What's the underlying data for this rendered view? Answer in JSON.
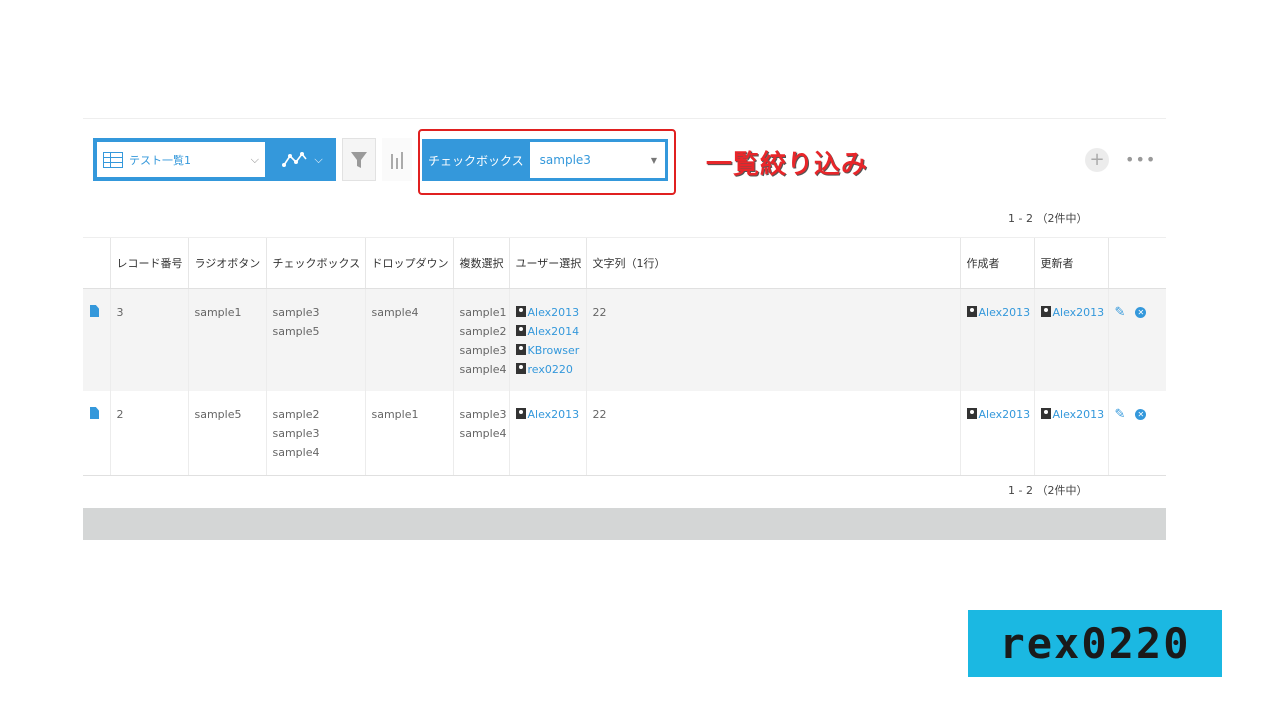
{
  "toolbar": {
    "view_name": "テスト一覧1",
    "filter_field_label": "チェックボックス",
    "filter_value": "sample3",
    "add_symbol": "+",
    "more_symbol": "•••"
  },
  "annotation": "一覧絞り込み",
  "pager": {
    "top": "1 - 2 （2件中）",
    "bottom": "1 - 2 （2件中）"
  },
  "table": {
    "headers": [
      "",
      "レコード番号",
      "ラジオボタン",
      "チェックボックス",
      "ドロップダウン",
      "複数選択",
      "ユーザー選択",
      "文字列（1行）",
      "作成者",
      "更新者",
      ""
    ],
    "rows": [
      {
        "record_no": "3",
        "radio": "sample1",
        "checkbox": [
          "sample3",
          "sample5"
        ],
        "dropdown": "sample4",
        "multi": [
          "sample1",
          "sample2",
          "sample3",
          "sample4"
        ],
        "users": [
          "Alex2013",
          "Alex2014",
          "KBrowser",
          "rex0220"
        ],
        "text": "22",
        "creator": "Alex2013",
        "updater": "Alex2013"
      },
      {
        "record_no": "2",
        "radio": "sample5",
        "checkbox": [
          "sample2",
          "sample3",
          "sample4"
        ],
        "dropdown": "sample1",
        "multi": [
          "sample3",
          "sample4"
        ],
        "users": [
          "Alex2013"
        ],
        "text": "22",
        "creator": "Alex2013",
        "updater": "Alex2013"
      }
    ]
  },
  "brand": "rex0220",
  "colors": {
    "accent": "#3498db",
    "annotation": "#e8262a",
    "brand_bg": "#1bb8e2"
  },
  "icons": [
    "table-icon",
    "graph-icon",
    "filter-icon",
    "bar-chart-icon",
    "plus-icon",
    "more-icon",
    "document-icon",
    "user-icon",
    "edit-icon",
    "delete-icon"
  ]
}
